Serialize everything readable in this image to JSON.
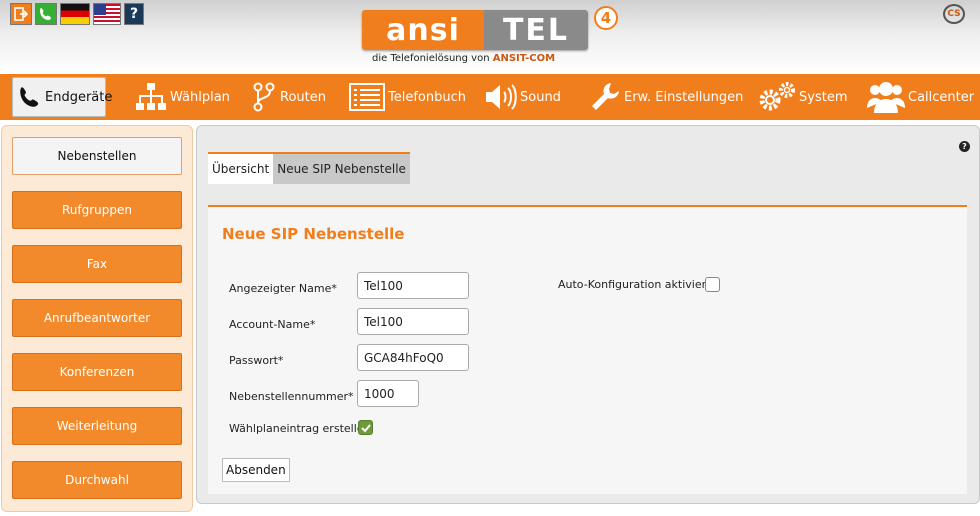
{
  "header": {
    "logo_left": "ansi",
    "logo_right": "TEL",
    "logo_version": "4",
    "tagline": "die Telefonielösung von",
    "tagline_brand": "ANSIT-COM",
    "cs_logo": "CS"
  },
  "quick_icons": [
    "logout-icon",
    "phone-icon",
    "flag-de-icon",
    "flag-us-icon",
    "help-icon"
  ],
  "nav": {
    "items": [
      {
        "label": "Endgeräte",
        "icon": "phone-icon"
      },
      {
        "label": "Wählplan",
        "icon": "tree-icon"
      },
      {
        "label": "Routen",
        "icon": "route-icon"
      },
      {
        "label": "Telefonbuch",
        "icon": "list-icon"
      },
      {
        "label": "Sound",
        "icon": "speaker-icon"
      },
      {
        "label": "Erw. Einstellungen",
        "icon": "wrench-icon"
      },
      {
        "label": "System",
        "icon": "gears-icon"
      },
      {
        "label": "Callcenter",
        "icon": "users-icon"
      }
    ],
    "active": "Endgeräte"
  },
  "sidebar": {
    "items": [
      {
        "label": "Nebenstellen"
      },
      {
        "label": "Rufgruppen"
      },
      {
        "label": "Fax"
      },
      {
        "label": "Anrufbeantworter"
      },
      {
        "label": "Konferenzen"
      },
      {
        "label": "Weiterleitung"
      },
      {
        "label": "Durchwahl"
      }
    ],
    "active": "Nebenstellen"
  },
  "main": {
    "help": "?",
    "tabs": [
      {
        "label": "Übersicht"
      },
      {
        "label": "Neue SIP Nebenstelle"
      }
    ],
    "form": {
      "title": "Neue SIP Nebenstelle",
      "display_name_label": "Angezeigter Name*",
      "display_name_value": "Tel100",
      "account_name_label": "Account-Name*",
      "account_name_value": "Tel100",
      "password_label": "Passwort*",
      "password_value": "GCA84hFoQ0",
      "extension_label": "Nebenstellennummer*",
      "extension_value": "1000",
      "dialplan_label": "Wählplaneintrag erstellen",
      "dialplan_checked": true,
      "autoconfig_label": "Auto-Konfiguration aktivieren",
      "autoconfig_checked": false,
      "submit_label": "Absenden"
    }
  },
  "colors": {
    "accent": "#f07e1c",
    "sidebar_bg": "#fce9d6",
    "check_green": "#6f9a3a"
  }
}
